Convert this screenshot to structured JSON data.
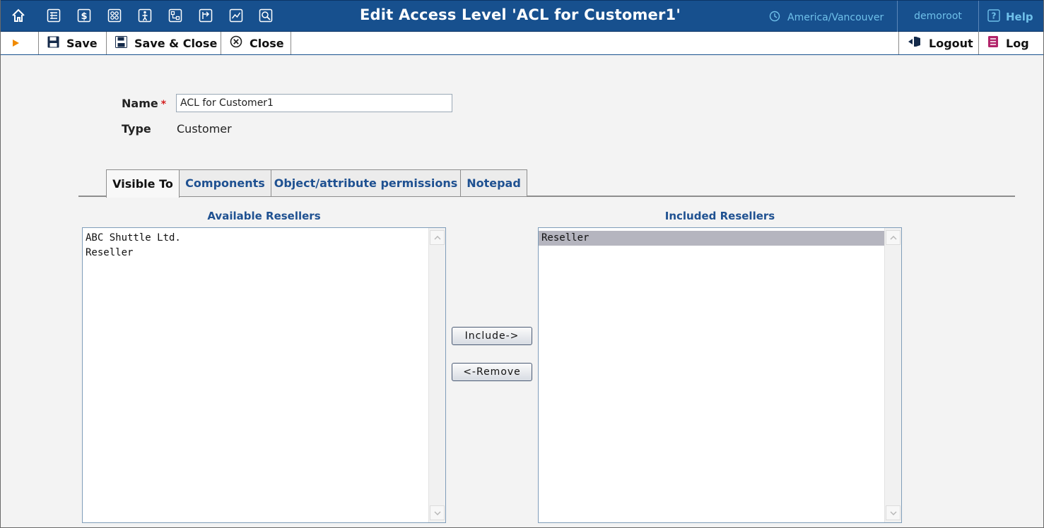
{
  "window": {
    "title": "Edit Access Level 'ACL for Customer1'",
    "timezone": "America/Vancouver",
    "username": "demoroot",
    "help_label": "Help"
  },
  "nav_icons": [
    "home-icon",
    "list-icon",
    "dollar-icon",
    "grid-icon",
    "person-icon",
    "network-icon",
    "export-icon",
    "chart-icon",
    "search-icon"
  ],
  "toolbar": {
    "save_label": "Save",
    "save_close_label": "Save & Close",
    "close_label": "Close",
    "logout_label": "Logout",
    "log_label": "Log"
  },
  "form": {
    "name_label": "Name",
    "required_mark": "*",
    "name_value": "ACL for Customer1",
    "type_label": "Type",
    "type_value": "Customer"
  },
  "tabs": [
    {
      "label": "Visible To",
      "active": true
    },
    {
      "label": "Components",
      "active": false
    },
    {
      "label": "Object/attribute permissions",
      "active": false
    },
    {
      "label": "Notepad",
      "active": false
    }
  ],
  "available": {
    "caption": "Available Resellers",
    "items": [
      "ABC Shuttle Ltd.",
      "Reseller"
    ]
  },
  "included": {
    "caption": "Included Resellers",
    "items": [
      "Reseller"
    ],
    "selected_index": 0
  },
  "buttons": {
    "include_label": "Include->",
    "remove_label": "<-Remove"
  },
  "colors": {
    "header_bg": "#17508e",
    "accent_link": "#1f5191",
    "header_link": "#6fc0ea",
    "required": "#d42020"
  }
}
